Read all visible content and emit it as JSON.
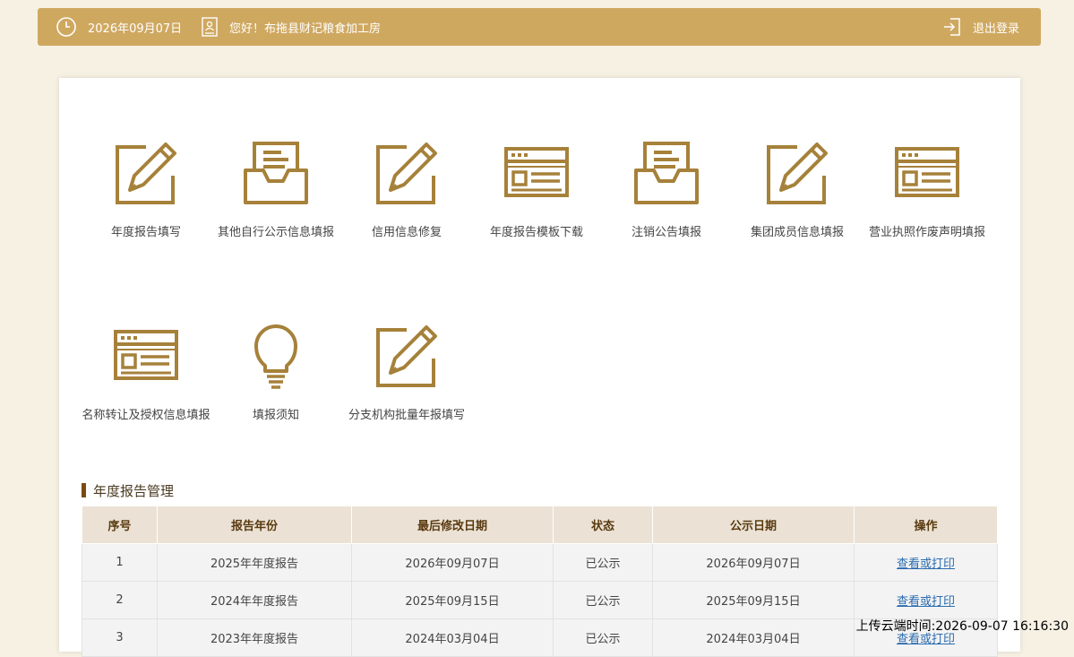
{
  "header": {
    "date": "2026年09月07日",
    "greeting": "您好！布拖县财记粮食加工房",
    "logout": "退出登录"
  },
  "colors": {
    "accent": "#cfa860",
    "icon": "#a6813a",
    "section_bar": "#7a4a0f",
    "link": "#2b6cb0"
  },
  "tiles": [
    {
      "label": "年度报告填写",
      "icon": "edit-icon"
    },
    {
      "label": "其他自行公示信息填报",
      "icon": "inbox-icon"
    },
    {
      "label": "信用信息修复",
      "icon": "edit-icon"
    },
    {
      "label": "年度报告模板下载",
      "icon": "browser-window-icon"
    },
    {
      "label": "注销公告填报",
      "icon": "inbox-icon"
    },
    {
      "label": "集团成员信息填报",
      "icon": "edit-icon"
    },
    {
      "label": "营业执照作废声明填报",
      "icon": "browser-window-icon"
    },
    {
      "label": "名称转让及授权信息填报",
      "icon": "browser-window-icon"
    },
    {
      "label": "填报须知",
      "icon": "lightbulb-icon"
    },
    {
      "label": "分支机构批量年报填写",
      "icon": "edit-icon"
    }
  ],
  "annual_reports": {
    "title": "年度报告管理",
    "headers": [
      "序号",
      "报告年份",
      "最后修改日期",
      "状态",
      "公示日期",
      "操作"
    ],
    "rows": [
      [
        "1",
        "2025年年度报告",
        "2026年09月07日",
        "已公示",
        "2026年09月07日",
        "查看或打印"
      ],
      [
        "2",
        "2024年年度报告",
        "2025年09月15日",
        "已公示",
        "2025年09月15日",
        "查看或打印"
      ],
      [
        "3",
        "2023年年度报告",
        "2024年03月04日",
        "已公示",
        "2024年03月04日",
        "查看或打印"
      ]
    ]
  },
  "watermark": "上传云端时间:2026-09-07 16:16:30"
}
